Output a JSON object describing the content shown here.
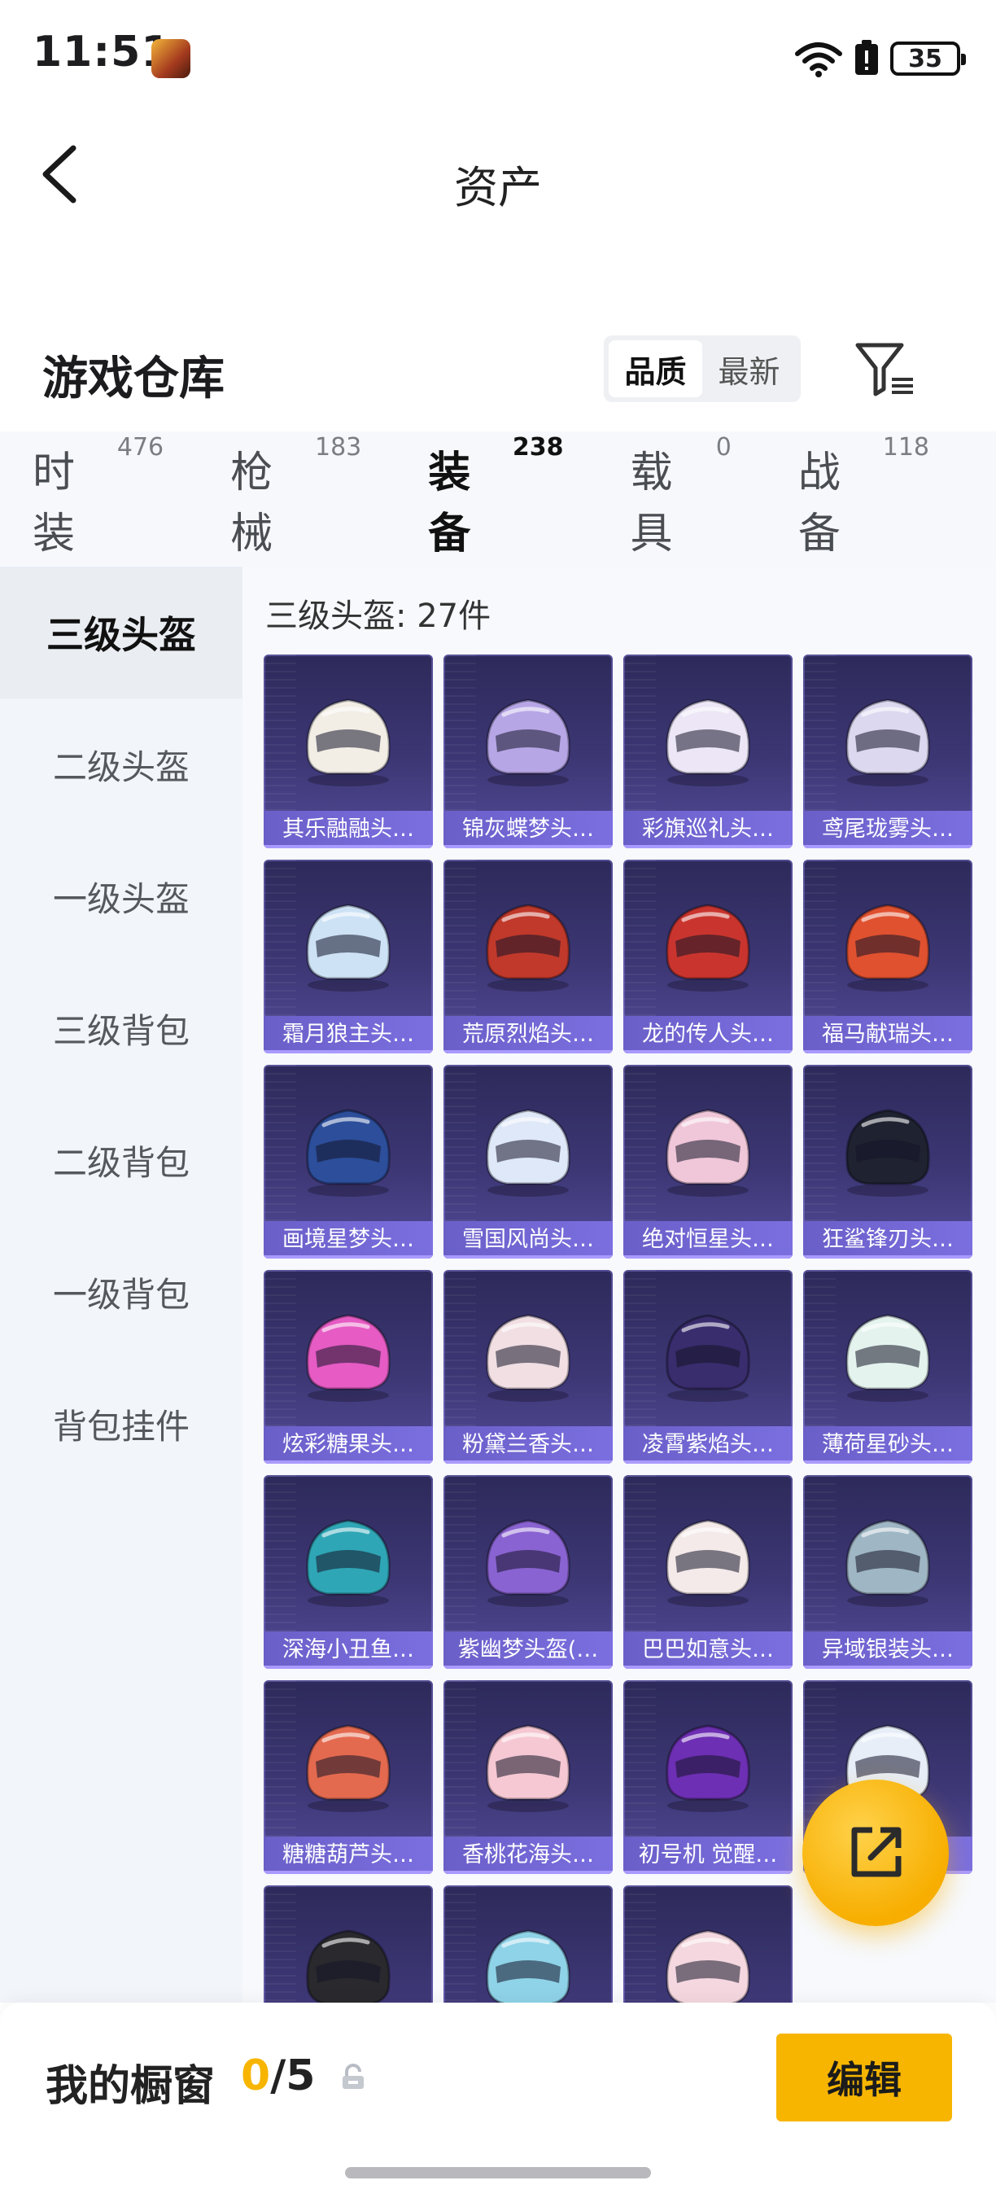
{
  "status_bar": {
    "time": "11:51",
    "battery": "35",
    "icons": [
      "game-app-icon",
      "wifi-icon",
      "battery-saver-icon",
      "battery-icon"
    ]
  },
  "nav": {
    "title": "资产",
    "back_icon": "back-arrow-icon"
  },
  "header": {
    "title": "游戏仓库",
    "sort_options": [
      "品质",
      "最新"
    ],
    "sort_active": "品质",
    "filter_icon": "filter-icon"
  },
  "tabs": [
    {
      "label": "时装",
      "count": "476"
    },
    {
      "label": "枪械",
      "count": "183"
    },
    {
      "label": "装备",
      "count": "238"
    },
    {
      "label": "载具",
      "count": "0"
    },
    {
      "label": "战备",
      "count": "118"
    }
  ],
  "active_tab": "装备",
  "sidebar": {
    "items": [
      {
        "label": "三级头盔"
      },
      {
        "label": "二级头盔"
      },
      {
        "label": "一级头盔"
      },
      {
        "label": "三级背包"
      },
      {
        "label": "二级背包"
      },
      {
        "label": "一级背包"
      },
      {
        "label": "背包挂件"
      }
    ],
    "active": "三级头盔"
  },
  "content": {
    "heading": "三级头盔: 27件",
    "items": [
      {
        "name": "其乐融融头…",
        "color": "#f2eee6"
      },
      {
        "name": "锦灰蝶梦头…",
        "color": "#b7a6e6"
      },
      {
        "name": "彩旗巡礼头…",
        "color": "#ece6f6"
      },
      {
        "name": "鸢尾珑雾头…",
        "color": "#dcd8ef"
      },
      {
        "name": "霜月狼主头…",
        "color": "#cde2f5"
      },
      {
        "name": "荒原烈焰头…",
        "color": "#c0392b"
      },
      {
        "name": "龙的传人头…",
        "color": "#c9352e"
      },
      {
        "name": "福马献瑞头…",
        "color": "#e0512f"
      },
      {
        "name": "画境星梦头…",
        "color": "#2c4e9b"
      },
      {
        "name": "雪国风尚头…",
        "color": "#dfe8f8"
      },
      {
        "name": "绝对恒星头…",
        "color": "#f0c7d9"
      },
      {
        "name": "狂鲨锋刃头…",
        "color": "#1f2230"
      },
      {
        "name": "炫彩糖果头…",
        "color": "#e65bc4"
      },
      {
        "name": "粉黛兰香头…",
        "color": "#f1dfe4"
      },
      {
        "name": "凌霄紫焰头…",
        "color": "#3a2d6e"
      },
      {
        "name": "薄荷星砂头…",
        "color": "#e4f3ee"
      },
      {
        "name": "深海小丑鱼…",
        "color": "#2fa6b6"
      },
      {
        "name": "紫幽梦头盔(…",
        "color": "#8a63d2"
      },
      {
        "name": "巴巴如意头…",
        "color": "#f4eaea"
      },
      {
        "name": "异域银装头…",
        "color": "#9fb6c4"
      },
      {
        "name": "糖糖葫芦头…",
        "color": "#e46a4f"
      },
      {
        "name": "香桃花海头…",
        "color": "#f6c8d3"
      },
      {
        "name": "初号机 觉醒…",
        "color": "#6d2fb3"
      },
      {
        "name": "",
        "color": "#e7eef8"
      },
      {
        "name": "",
        "color": "#2a2a2e"
      },
      {
        "name": "",
        "color": "#8fd3e8"
      },
      {
        "name": "",
        "color": "#f4d7df"
      }
    ]
  },
  "fab": {
    "icon": "share-export-icon"
  },
  "bottom": {
    "title": "我的橱窗",
    "current": "0",
    "separator": "/",
    "max": "5",
    "lock_icon": "lock-icon",
    "edit_label": "编辑"
  }
}
